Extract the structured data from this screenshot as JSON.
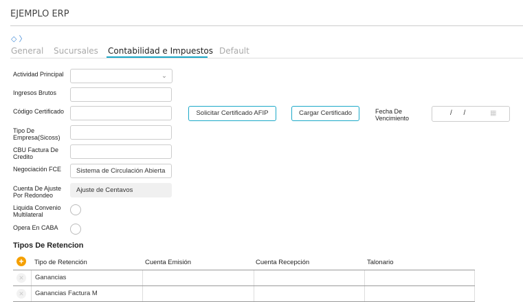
{
  "app_title": "EJEMPLO ERP",
  "tabs": [
    "General",
    "Sucursales",
    "Contabilidad e Impuestos",
    "Default"
  ],
  "form": {
    "actividad_principal": {
      "label": "Actividad Principal",
      "value": ""
    },
    "ingresos_brutos": {
      "label": "Ingresos Brutos",
      "value": ""
    },
    "codigo_certificado": {
      "label": "Código Certificado",
      "value": ""
    },
    "tipo_empresa": {
      "label": "Tipo De Empresa(Sicoss)",
      "value": ""
    },
    "cbu": {
      "label": "CBU Factura De Credito",
      "value": ""
    },
    "negociacion_fce": {
      "label": "Negociación FCE",
      "value": "Sistema de Circulación Abierta"
    },
    "cuenta_ajuste": {
      "label": "Cuenta De Ajuste Por Redondeo",
      "value": "Ajuste de Centavos"
    },
    "liquida_convenio": {
      "label": "Liquida Convenio Multilateral"
    },
    "opera_caba": {
      "label": "Opera En CABA"
    },
    "solicitar_btn": "Solicitar Certificado AFIP",
    "cargar_btn": "Cargar Certificado",
    "fecha_label": "Fecha De Vencimiento",
    "fecha_value": "/ /"
  },
  "retenciones": {
    "title": "Tipos De Retencion",
    "headers": [
      "Tipo de Retención",
      "Cuenta Emisión",
      "Cuenta Recepción",
      "Talonario"
    ],
    "rows": [
      [
        "Ganancias",
        "",
        "",
        ""
      ],
      [
        "Ganancias Factura M",
        "",
        "",
        ""
      ]
    ]
  }
}
